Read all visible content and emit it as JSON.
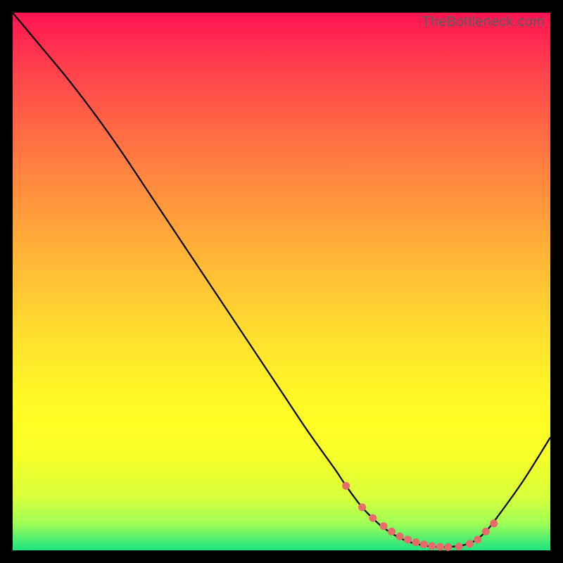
{
  "watermark": "TheBottleneck.com",
  "chart_data": {
    "type": "line",
    "title": "",
    "xlabel": "",
    "ylabel": "",
    "xlim": [
      0,
      100
    ],
    "ylim": [
      0,
      100
    ],
    "grid": false,
    "series": [
      {
        "name": "curve",
        "x": [
          0,
          5,
          10,
          15,
          20,
          25,
          30,
          35,
          40,
          45,
          50,
          55,
          60,
          62,
          65,
          68,
          70,
          72,
          74,
          76,
          78,
          80,
          82,
          84,
          86,
          88,
          90,
          95,
          100
        ],
        "y": [
          100,
          94,
          88,
          81.5,
          74.5,
          67,
          59.5,
          52,
          44.5,
          37,
          29.5,
          22,
          15,
          12,
          8,
          5,
          3.5,
          2.3,
          1.5,
          1.0,
          0.7,
          0.6,
          0.7,
          1.0,
          1.8,
          3.5,
          6,
          13,
          21
        ]
      }
    ],
    "markers": {
      "name": "highlight-dots",
      "color": "#e86a6a",
      "x": [
        62,
        65,
        67,
        69,
        70.5,
        72,
        73.5,
        75,
        76.5,
        78,
        79.5,
        81,
        83,
        85,
        86.5,
        88,
        89.5
      ],
      "y": [
        12,
        8,
        6,
        4.5,
        3.5,
        2.6,
        2.0,
        1.5,
        1.1,
        0.8,
        0.65,
        0.6,
        0.7,
        1.2,
        2.0,
        3.5,
        5.0
      ]
    }
  }
}
